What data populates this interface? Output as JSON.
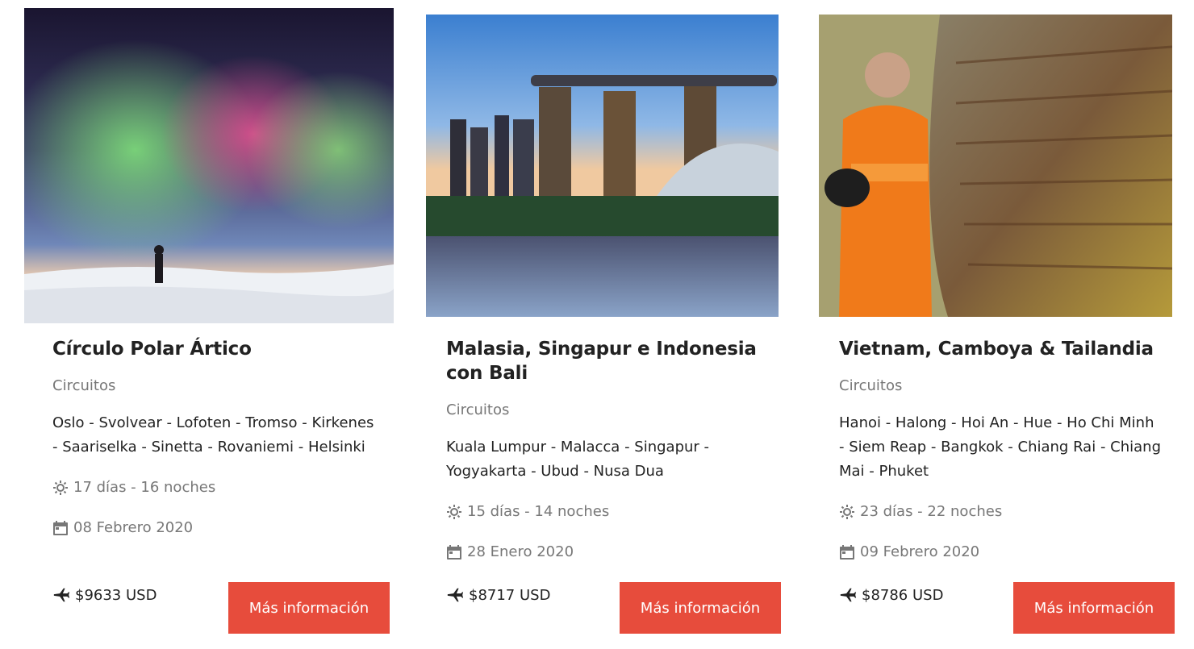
{
  "tours": [
    {
      "title": "Círculo Polar Ártico",
      "category": "Circuitos",
      "route": "Oslo - Svolvear - Lofoten - Tromso - Kirkenes - Saariselka - Sinetta - Rovaniemi - Helsinki",
      "duration": "17 días - 16 noches",
      "date": "08 Febrero 2020",
      "price": "$9633 USD",
      "button": "Más información"
    },
    {
      "title": "Malasia, Singapur e Indonesia con Bali",
      "category": "Circuitos",
      "route": "Kuala Lumpur - Malacca - Singapur - Yogyakarta - Ubud - Nusa Dua",
      "duration": "15 días - 14 noches",
      "date": "28 Enero 2020",
      "price": "$8717 USD",
      "button": "Más información"
    },
    {
      "title": "Vietnam, Camboya & Tailandia",
      "category": "Circuitos",
      "route": "Hanoi - Halong - Hoi An - Hue - Ho Chi Minh - Siem Reap - Bangkok - Chiang Rai - Chiang Mai - Phuket",
      "duration": "23 días - 22 noches",
      "date": "09 Febrero 2020",
      "price": "$8786 USD",
      "button": "Más información"
    }
  ],
  "icons": {
    "duration": "sun-icon",
    "date": "calendar-icon",
    "price": "airplane-icon"
  },
  "colors": {
    "button": "#e74c3c",
    "muted_text": "#777777",
    "text": "#222222"
  }
}
